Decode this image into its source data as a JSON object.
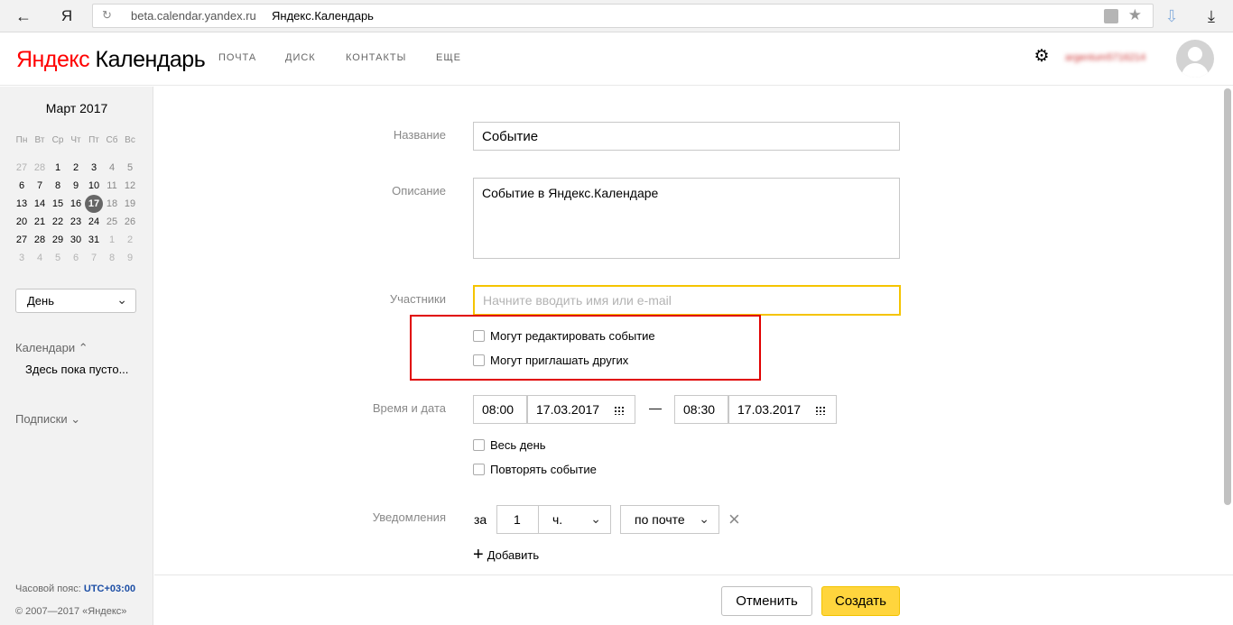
{
  "browser": {
    "back_icon": "arrow-left-icon",
    "yandex_glyph": "Я",
    "host": "beta.calendar.yandex.ru",
    "page_title": "Яндекс.Календарь"
  },
  "header": {
    "logo_brand": "Яндекс",
    "logo_product": "Календарь",
    "nav": [
      "ПОЧТА",
      "ДИСК",
      "КОНТАКТЫ",
      "ЕЩЕ"
    ],
    "username": "argentum5716214"
  },
  "sidebar": {
    "month_title": "Март 2017",
    "weekdays": [
      "Пн",
      "Вт",
      "Ср",
      "Чт",
      "Пт",
      "Сб",
      "Вс"
    ],
    "weeks": [
      [
        "27",
        "28",
        "1",
        "2",
        "3",
        "4",
        "5"
      ],
      [
        "6",
        "7",
        "8",
        "9",
        "10",
        "11",
        "12"
      ],
      [
        "13",
        "14",
        "15",
        "16",
        "17",
        "18",
        "19"
      ],
      [
        "20",
        "21",
        "22",
        "23",
        "24",
        "25",
        "26"
      ],
      [
        "27",
        "28",
        "29",
        "30",
        "31",
        "1",
        "2"
      ],
      [
        "3",
        "4",
        "5",
        "6",
        "7",
        "8",
        "9"
      ]
    ],
    "today": "17",
    "view_select": "День",
    "calendars_label": "Календари",
    "calendars_empty": "Здесь пока пусто...",
    "subscriptions_label": "Подписки",
    "timezone_label": "Часовой пояс:",
    "timezone_value": "UTC+03:00",
    "copyright": "© 2007—2017 «Яндекс»"
  },
  "form": {
    "name_label": "Название",
    "name_value": "Событие",
    "description_label": "Описание",
    "description_value": "Событие в Яндекс.Календаре",
    "participants_label": "Участники",
    "participants_placeholder": "Начните вводить имя или e-mail",
    "can_edit_label": "Могут редактировать событие",
    "can_invite_label": "Могут приглашать других",
    "datetime_label": "Время и дата",
    "start_time": "08:00",
    "start_date": "17.03.2017",
    "dash": "—",
    "end_time": "08:30",
    "end_date": "17.03.2017",
    "all_day_label": "Весь день",
    "repeat_label": "Повторять событие",
    "notifications_label": "Уведомления",
    "notify_prefix": "за",
    "notify_amount": "1",
    "notify_unit": "ч.",
    "notify_channel": "по почте",
    "add_label": "Добавить"
  },
  "footer": {
    "cancel_label": "Отменить",
    "create_label": "Создать"
  },
  "colors": {
    "accent_yellow": "#ffd53d",
    "focus_border": "#f5c400",
    "highlight_red": "#e00000",
    "logo_red": "#ff0000"
  }
}
